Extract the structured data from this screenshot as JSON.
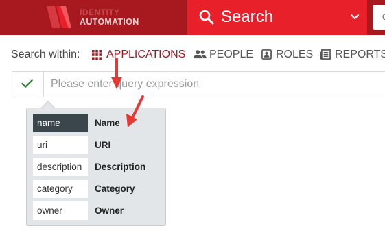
{
  "header": {
    "logo_line1": "IDENTITY",
    "logo_line2": "AUTOMATION",
    "search_label": "Search",
    "right_input_partial": "C"
  },
  "search_within": {
    "label": "Search within:",
    "options": [
      {
        "label": "APPLICATIONS",
        "icon": "grid-icon",
        "active": true
      },
      {
        "label": "PEOPLE",
        "icon": "people-icon",
        "active": false
      },
      {
        "label": "ROLES",
        "icon": "badge-icon",
        "active": false
      },
      {
        "label": "REPORTS",
        "icon": "report-icon",
        "active": false
      }
    ]
  },
  "query": {
    "placeholder": "Please enter query expression",
    "value": ""
  },
  "autocomplete": {
    "items": [
      {
        "key": "name",
        "label": "Name",
        "selected": true
      },
      {
        "key": "uri",
        "label": "URI",
        "selected": false
      },
      {
        "key": "description",
        "label": "Description",
        "selected": false
      },
      {
        "key": "category",
        "label": "Category",
        "selected": false
      },
      {
        "key": "owner",
        "label": "Owner",
        "selected": false
      }
    ]
  },
  "colors": {
    "header_bg": "#a8191f",
    "search_bg": "#e8202a",
    "active_option": "#a8191f",
    "check": "#2e7d32",
    "selected_key_bg": "#3b464c",
    "annotation_arrow": "#e53935"
  }
}
